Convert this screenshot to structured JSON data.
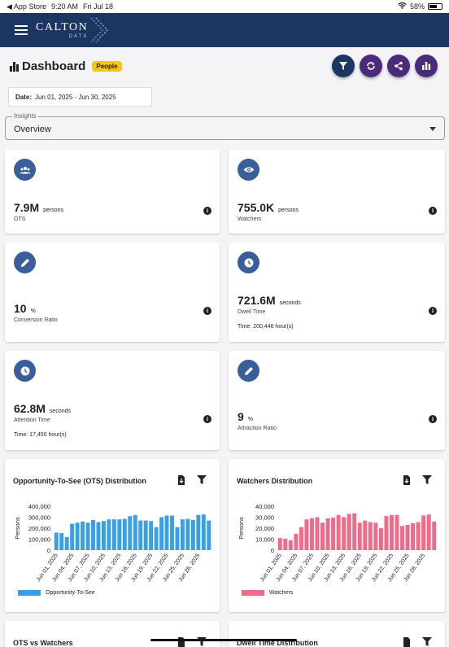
{
  "statusbar": {
    "back_app": "◀ App Store",
    "time": "9:20 AM",
    "date": "Fri Jul 18",
    "battery": "58%"
  },
  "brand": {
    "name": "CALTON",
    "sub": "DATX"
  },
  "dashboard": {
    "title": "Dashboard",
    "badge": "People"
  },
  "date_range": {
    "label": "Date:",
    "value": "Jun 01, 2025 - Jun 30, 2025"
  },
  "insights": {
    "legend": "Insights",
    "selected": "Overview"
  },
  "metrics": [
    {
      "value": "7.9M",
      "unit": "persons",
      "label": "OTS",
      "icon": "people-icon"
    },
    {
      "value": "755.0K",
      "unit": "persons",
      "label": "Watchers",
      "icon": "eye-icon"
    },
    {
      "value": "10",
      "unit": "%",
      "label": "Conversion Ratio",
      "icon": "pencil-icon"
    },
    {
      "value": "721.6M",
      "unit": "seconds",
      "label": "Dwell Time",
      "extra": "Time: 200,446 hour(s)",
      "icon": "clock-icon"
    },
    {
      "value": "62.8M",
      "unit": "seconds",
      "label": "Attention Time",
      "extra": "Time: 17,450 hour(s)",
      "icon": "clock-icon"
    },
    {
      "value": "9",
      "unit": "%",
      "label": "Attraction Ratio",
      "icon": "pencil-icon"
    }
  ],
  "charts_titles": {
    "ots": "Opportunity-To-See (OTS) Distribution",
    "watchers": "Watchers Distribution",
    "ots_vs_watchers": "OTS vs Watchers",
    "dwell": "Dwell Time Distribution"
  },
  "colors": {
    "navy": "#1c3663",
    "purple": "#4a2a7a",
    "icon_blue": "#3a5e99",
    "ots_bar": "#3aa0e6",
    "watchers_bar": "#f06a8a",
    "badge": "#f5c518"
  },
  "chart_data": [
    {
      "type": "bar",
      "title": "Opportunity-To-See (OTS) Distribution",
      "ylabel": "Persons",
      "ylim": [
        0,
        400000
      ],
      "yticks": [
        "400,000",
        "300,000",
        "200,000",
        "100,000",
        "0"
      ],
      "xtick_labels": [
        "Jun 01, 2025",
        "Jun 04, 2025",
        "Jun 07, 2025",
        "Jun 10, 2025",
        "Jun 13, 2025",
        "Jun 16, 2025",
        "Jun 19, 2025",
        "Jun 22, 2025",
        "Jun 25, 2025",
        "Jun 28, 2025"
      ],
      "series": [
        {
          "name": "Opportunity-To-See",
          "color": "#3aa0e6",
          "values": [
            160000,
            155000,
            120000,
            240000,
            250000,
            260000,
            250000,
            275000,
            255000,
            265000,
            280000,
            280000,
            280000,
            285000,
            310000,
            320000,
            270000,
            270000,
            265000,
            210000,
            300000,
            315000,
            315000,
            210000,
            280000,
            285000,
            275000,
            320000,
            325000,
            270000
          ]
        }
      ]
    },
    {
      "type": "bar",
      "title": "Watchers Distribution",
      "ylabel": "Persons",
      "ylim": [
        0,
        40000
      ],
      "yticks": [
        "40,000",
        "30,000",
        "20,000",
        "10,000",
        "0"
      ],
      "xtick_labels": [
        "Jun 01, 2025",
        "Jun 04, 2025",
        "Jun 07, 2025",
        "Jun 10, 2025",
        "Jun 13, 2025",
        "Jun 16, 2025",
        "Jun 19, 2025",
        "Jun 22, 2025",
        "Jun 25, 2025",
        "Jun 28, 2025"
      ],
      "series": [
        {
          "name": "Watchers",
          "color": "#f06a8a",
          "values": [
            11000,
            10500,
            9000,
            15000,
            21000,
            28000,
            29000,
            30000,
            25000,
            29000,
            29500,
            32000,
            30000,
            33000,
            33500,
            25000,
            27000,
            25500,
            25000,
            20000,
            31000,
            32000,
            32000,
            22000,
            23000,
            24500,
            25500,
            31500,
            32500,
            26000
          ]
        }
      ]
    }
  ]
}
